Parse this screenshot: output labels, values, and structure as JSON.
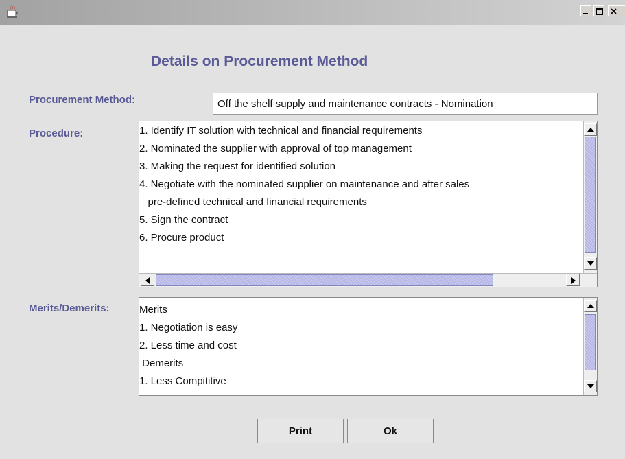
{
  "window": {
    "title": "",
    "minimize_icon": "minimize-icon",
    "maximize_icon": "maximize-icon",
    "close_icon": "close-icon",
    "app_icon": "java-cup-icon"
  },
  "heading": "Details on Procurement Method",
  "method": {
    "label": "Procurement Method:",
    "value": "Off the shelf supply and maintenance contracts - Nomination"
  },
  "procedure": {
    "label": "Procedure:",
    "lines": [
      "1. Identify IT solution with technical and financial requirements",
      "2. Nominated the supplier with approval of top management",
      "3. Making the request for identified solution",
      "4. Negotiate with the nominated supplier on maintenance and after sales",
      "   pre-defined technical and financial requirements",
      "5. Sign the contract",
      "6. Procure product"
    ]
  },
  "merits": {
    "label": "Merits/Demerits:",
    "lines": [
      "Merits",
      "1. Negotiation is easy",
      "2. Less time and cost",
      " Demerits",
      "1. Less Compititive"
    ]
  },
  "buttons": {
    "print": "Print",
    "ok": "Ok"
  },
  "colors": {
    "label": "#5a5a96",
    "thumb": "#b5b5e6",
    "background": "#e2e2e2"
  }
}
